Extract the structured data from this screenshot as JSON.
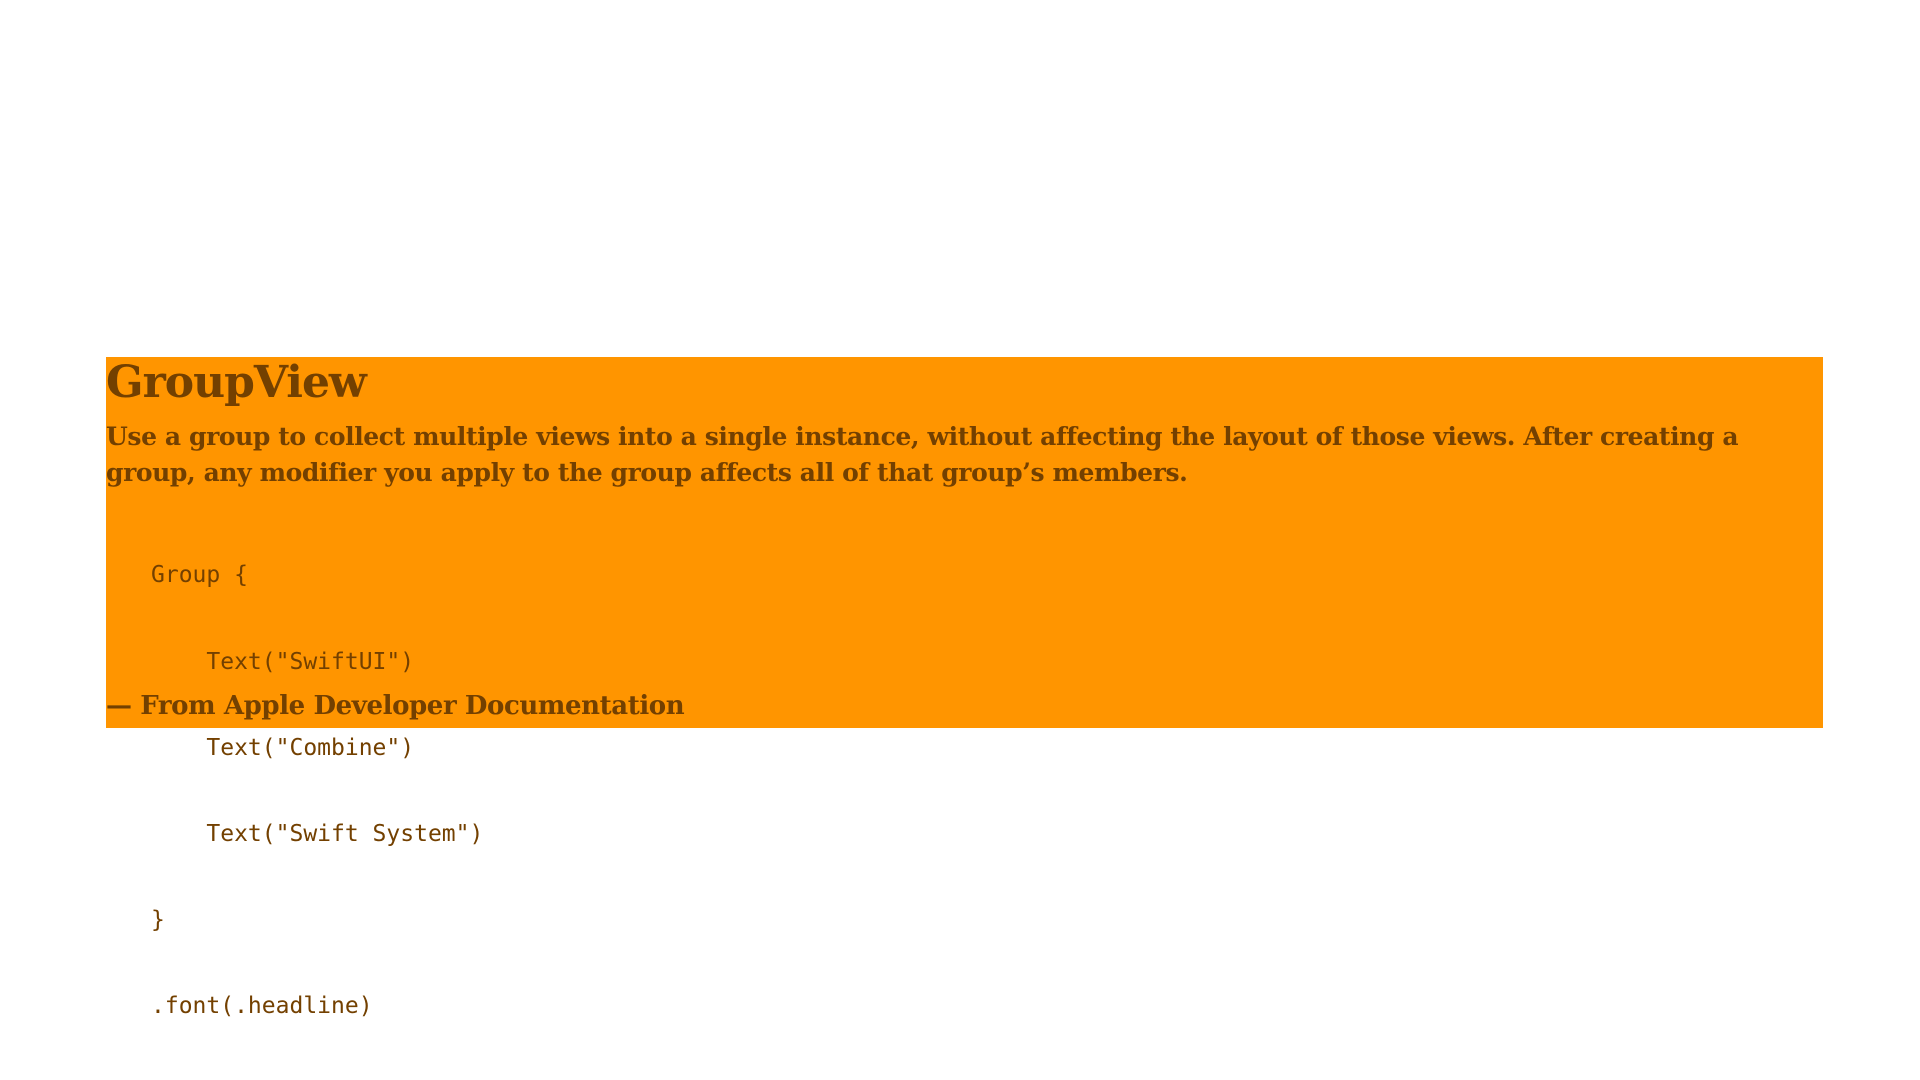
{
  "quote": {
    "title": "GroupView",
    "description": "Use a group to collect multiple views into a single instance, without affecting the layout of those views. After creating a group, any modifier you apply to the group affects all of that group’s members.",
    "code_lines": [
      "Group {",
      "    Text(\"SwiftUI\")",
      "    Text(\"Combine\")",
      "    Text(\"Swift System\")",
      "}",
      ".font(.headline)"
    ],
    "attribution": "— From Apple Developer Documentation"
  },
  "colors": {
    "background": "#FFFFFF",
    "box": "#FF9500",
    "text": "#734000"
  }
}
